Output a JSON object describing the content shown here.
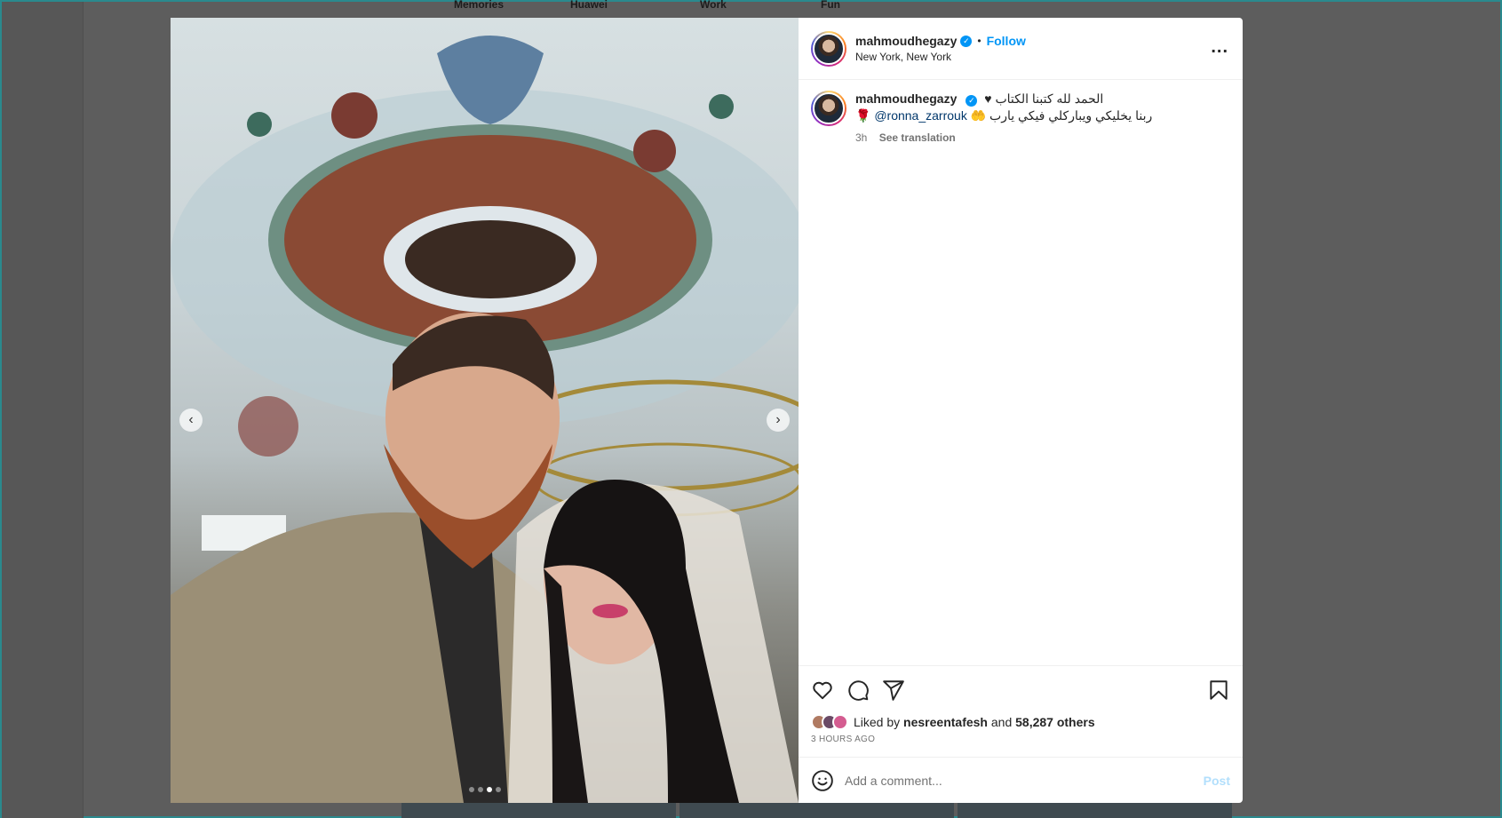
{
  "background": {
    "nav": [
      "Memories",
      "Huawei",
      "Work",
      "Fun"
    ]
  },
  "post": {
    "username": "mahmoudhegazy",
    "verified_mark": "✓",
    "follow_label": "Follow",
    "location": "New York, New York",
    "more_label": "...",
    "caption_line1": "الحمد لله كتبنا الكتاب ♥",
    "caption_line2": "ربنا يخليكي ويباركلي فيكي يارب",
    "mention": "@ronna_zarrouk",
    "time": "3h",
    "see_translation": "See translation",
    "liked_by_prefix": "Liked by",
    "liked_by_user": "nesreentafesh",
    "liked_by_and": "and",
    "liked_by_others": "58,287 others",
    "time_ago": "3 HOURS AGO",
    "comment_placeholder": "Add a comment...",
    "post_label": "Post",
    "carousel": {
      "count": 4,
      "active_index": 2
    }
  },
  "colors": {
    "accent": "#0095f6",
    "post_disabled": "#b2dffc",
    "backdrop": "#5d5d5d"
  },
  "icons": [
    "heart-icon",
    "comment-icon",
    "share-icon",
    "bookmark-icon",
    "emoji-icon",
    "more-icon",
    "chevron-left-icon",
    "chevron-right-icon",
    "verified-icon"
  ]
}
